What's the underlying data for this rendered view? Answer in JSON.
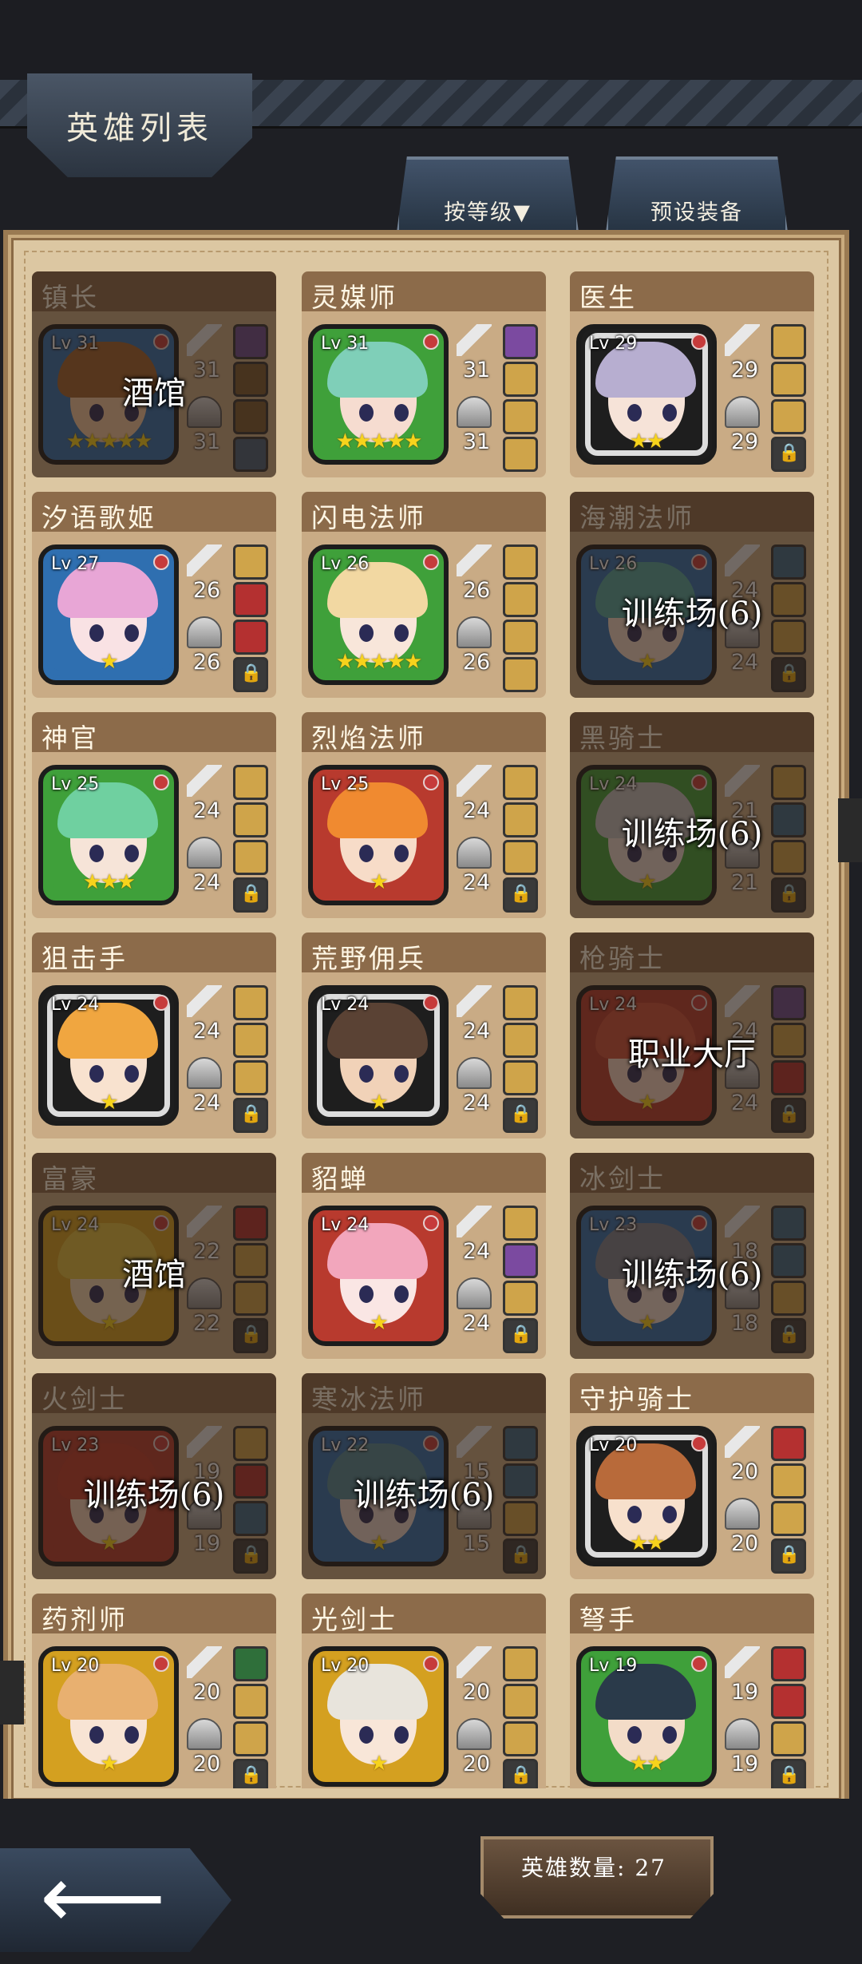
{
  "header": {
    "title": "英雄列表"
  },
  "tabs": [
    {
      "label": "按等级▼"
    },
    {
      "label": "预设装备"
    }
  ],
  "footer": {
    "hero_count": "英雄数量: 27"
  },
  "heroes": [
    {
      "name": "镇长",
      "lv": "Lv 31",
      "weapon": "31",
      "armor": "31",
      "stars": "★★★★★",
      "frame": "#2f6fb0",
      "hair": "#a0622e",
      "skin": "#f2c9a0",
      "dim": true,
      "overlay": "酒馆",
      "slots": [
        "#6a4a90",
        "#7a5a30",
        "#7a5a30",
        "#44607a"
      ]
    },
    {
      "name": "灵媒师",
      "lv": "Lv 31",
      "weapon": "31",
      "armor": "31",
      "stars": "★★★★★",
      "frame": "#3fa03a",
      "hair": "#7fcfb8",
      "skin": "#f6dcd0",
      "dim": false,
      "overlay": "",
      "slots": [
        "#7b4aa0",
        "#cfa44a",
        "#cfa44a",
        "#cfa44a"
      ]
    },
    {
      "name": "医生",
      "lv": "Lv 29",
      "weapon": "29",
      "armor": "29",
      "stars": "★★",
      "frame": "#1e1e1e",
      "hair": "#b7aed0",
      "skin": "#f6e3d8",
      "dim": false,
      "overlay": "",
      "slots": [
        "#cfa44a",
        "#cfa44a",
        "#cfa44a",
        "lock"
      ]
    },
    {
      "name": "汐语歌姬",
      "lv": "Lv 27",
      "weapon": "26",
      "armor": "26",
      "stars": "★",
      "frame": "#2f6fb0",
      "hair": "#e8a6d6",
      "skin": "#f9e2e4",
      "dim": false,
      "overlay": "",
      "slots": [
        "#cfa44a",
        "#b43030",
        "#b43030",
        "lock"
      ]
    },
    {
      "name": "闪电法师",
      "lv": "Lv 26",
      "weapon": "26",
      "armor": "26",
      "stars": "★★★★★",
      "frame": "#3fa03a",
      "hair": "#f2d8a2",
      "skin": "#f8e6da",
      "dim": false,
      "overlay": "",
      "slots": [
        "#cfa44a",
        "#cfa44a",
        "#cfa44a",
        "#cfa44a"
      ]
    },
    {
      "name": "海潮法师",
      "lv": "Lv 26",
      "weapon": "24",
      "armor": "24",
      "stars": "★",
      "frame": "#2f6fb0",
      "hair": "#4fa6a0",
      "skin": "#f0d8c8",
      "dim": true,
      "overlay": "训练场(6)",
      "slots": [
        "#3b6a8a",
        "#cfa44a",
        "#cfa44a",
        "lock"
      ]
    },
    {
      "name": "神官",
      "lv": "Lv 25",
      "weapon": "24",
      "armor": "24",
      "stars": "★★★",
      "frame": "#3fa03a",
      "hair": "#6fd0a0",
      "skin": "#f6e4d8",
      "dim": false,
      "overlay": "",
      "slots": [
        "#cfa44a",
        "#cfa44a",
        "#cfa44a",
        "lock"
      ]
    },
    {
      "name": "烈焰法师",
      "lv": "Lv 25",
      "weapon": "24",
      "armor": "24",
      "stars": "★",
      "frame": "#b83a2e",
      "hair": "#f08a30",
      "skin": "#f7dcc8",
      "dim": false,
      "overlay": "",
      "slots": [
        "#cfa44a",
        "#cfa44a",
        "#cfa44a",
        "lock"
      ]
    },
    {
      "name": "黑骑士",
      "lv": "Lv 24",
      "weapon": "21",
      "armor": "21",
      "stars": "★",
      "frame": "#3fa03a",
      "hair": "#bfbfbf",
      "skin": "#e8d8d0",
      "dim": true,
      "overlay": "训练场(6)",
      "slots": [
        "#cfa44a",
        "#3b6a8a",
        "#cfa44a",
        "lock"
      ]
    },
    {
      "name": "狙击手",
      "lv": "Lv 24",
      "weapon": "24",
      "armor": "24",
      "stars": "★",
      "frame": "#1e1e1e",
      "hair": "#f0a640",
      "skin": "#f8e2cf",
      "dim": false,
      "overlay": "",
      "slots": [
        "#cfa44a",
        "#cfa44a",
        "#cfa44a",
        "lock"
      ]
    },
    {
      "name": "荒野佣兵",
      "lv": "Lv 24",
      "weapon": "24",
      "armor": "24",
      "stars": "★",
      "frame": "#1e1e1e",
      "hair": "#5a4234",
      "skin": "#f1d2b8",
      "dim": false,
      "overlay": "",
      "slots": [
        "#cfa44a",
        "#cfa44a",
        "#cfa44a",
        "lock"
      ]
    },
    {
      "name": "枪骑士",
      "lv": "Lv 24",
      "weapon": "24",
      "armor": "24",
      "stars": "★",
      "frame": "#b83a2e",
      "hair": "#d0503a",
      "skin": "#f4d6c4",
      "dim": true,
      "overlay": "职业大厅",
      "slots": [
        "#6a4a90",
        "#cfa44a",
        "#b43030",
        "lock"
      ]
    },
    {
      "name": "富豪",
      "lv": "Lv 24",
      "weapon": "22",
      "armor": "22",
      "stars": "★",
      "frame": "#d4a020",
      "hair": "#e2c040",
      "skin": "#f2d8b4",
      "dim": true,
      "overlay": "酒馆",
      "slots": [
        "#b43030",
        "#cfa44a",
        "#cfa44a",
        "lock"
      ]
    },
    {
      "name": "貂蝉",
      "lv": "Lv 24",
      "weapon": "24",
      "armor": "24",
      "stars": "★",
      "frame": "#b83a2e",
      "hair": "#f2a6bc",
      "skin": "#fae6e4",
      "dim": false,
      "overlay": "",
      "slots": [
        "#cfa44a",
        "#7b4aa0",
        "#cfa44a",
        "lock"
      ]
    },
    {
      "name": "冰剑士",
      "lv": "Lv 23",
      "weapon": "18",
      "armor": "18",
      "stars": "★",
      "frame": "#2f6fb0",
      "hair": "#7a8090",
      "skin": "#efdcd2",
      "dim": true,
      "overlay": "训练场(6)",
      "slots": [
        "#3b6a8a",
        "#3b6a8a",
        "#cfa44a",
        "lock"
      ]
    },
    {
      "name": "火剑士",
      "lv": "Lv 23",
      "weapon": "19",
      "armor": "19",
      "stars": "★",
      "frame": "#b83a2e",
      "hair": "#c03a2a",
      "skin": "#f2d2bc",
      "dim": true,
      "overlay": "训练场(6)",
      "slots": [
        "#cfa44a",
        "#b43030",
        "#3b6a8a",
        "lock"
      ]
    },
    {
      "name": "寒冰法师",
      "lv": "Lv 22",
      "weapon": "15",
      "armor": "15",
      "stars": "★",
      "frame": "#2f6fb0",
      "hair": "#4f8a9a",
      "skin": "#e6d6cc",
      "dim": true,
      "overlay": "训练场(6)",
      "slots": [
        "#3b6a8a",
        "#3b6a8a",
        "#cfa44a",
        "lock"
      ]
    },
    {
      "name": "守护骑士",
      "lv": "Lv 20",
      "weapon": "20",
      "armor": "20",
      "stars": "★★",
      "frame": "#1e1e1e",
      "hair": "#b86a3a",
      "skin": "#f7e0cc",
      "dim": false,
      "overlay": "",
      "slots": [
        "#b43030",
        "#cfa44a",
        "#cfa44a",
        "lock"
      ]
    },
    {
      "name": "药剂师",
      "lv": "Lv 20",
      "weapon": "20",
      "armor": "20",
      "stars": "★",
      "frame": "#d4a020",
      "hair": "#e8b070",
      "skin": "#f8e4d4",
      "dim": false,
      "overlay": "",
      "slots": [
        "#2f6f3a",
        "#cfa44a",
        "#cfa44a",
        "lock"
      ]
    },
    {
      "name": "光剑士",
      "lv": "Lv 20",
      "weapon": "20",
      "armor": "20",
      "stars": "★",
      "frame": "#d4a020",
      "hair": "#e8e4dc",
      "skin": "#f8e6d8",
      "dim": false,
      "overlay": "",
      "slots": [
        "#cfa44a",
        "#cfa44a",
        "#cfa44a",
        "lock"
      ]
    },
    {
      "name": "弩手",
      "lv": "Lv 19",
      "weapon": "19",
      "armor": "19",
      "stars": "★★",
      "frame": "#3fa03a",
      "hair": "#2a3a4a",
      "skin": "#f3dcc8",
      "dim": false,
      "overlay": "",
      "slots": [
        "#b43030",
        "#b43030",
        "#cfa44a",
        "lock"
      ]
    }
  ]
}
